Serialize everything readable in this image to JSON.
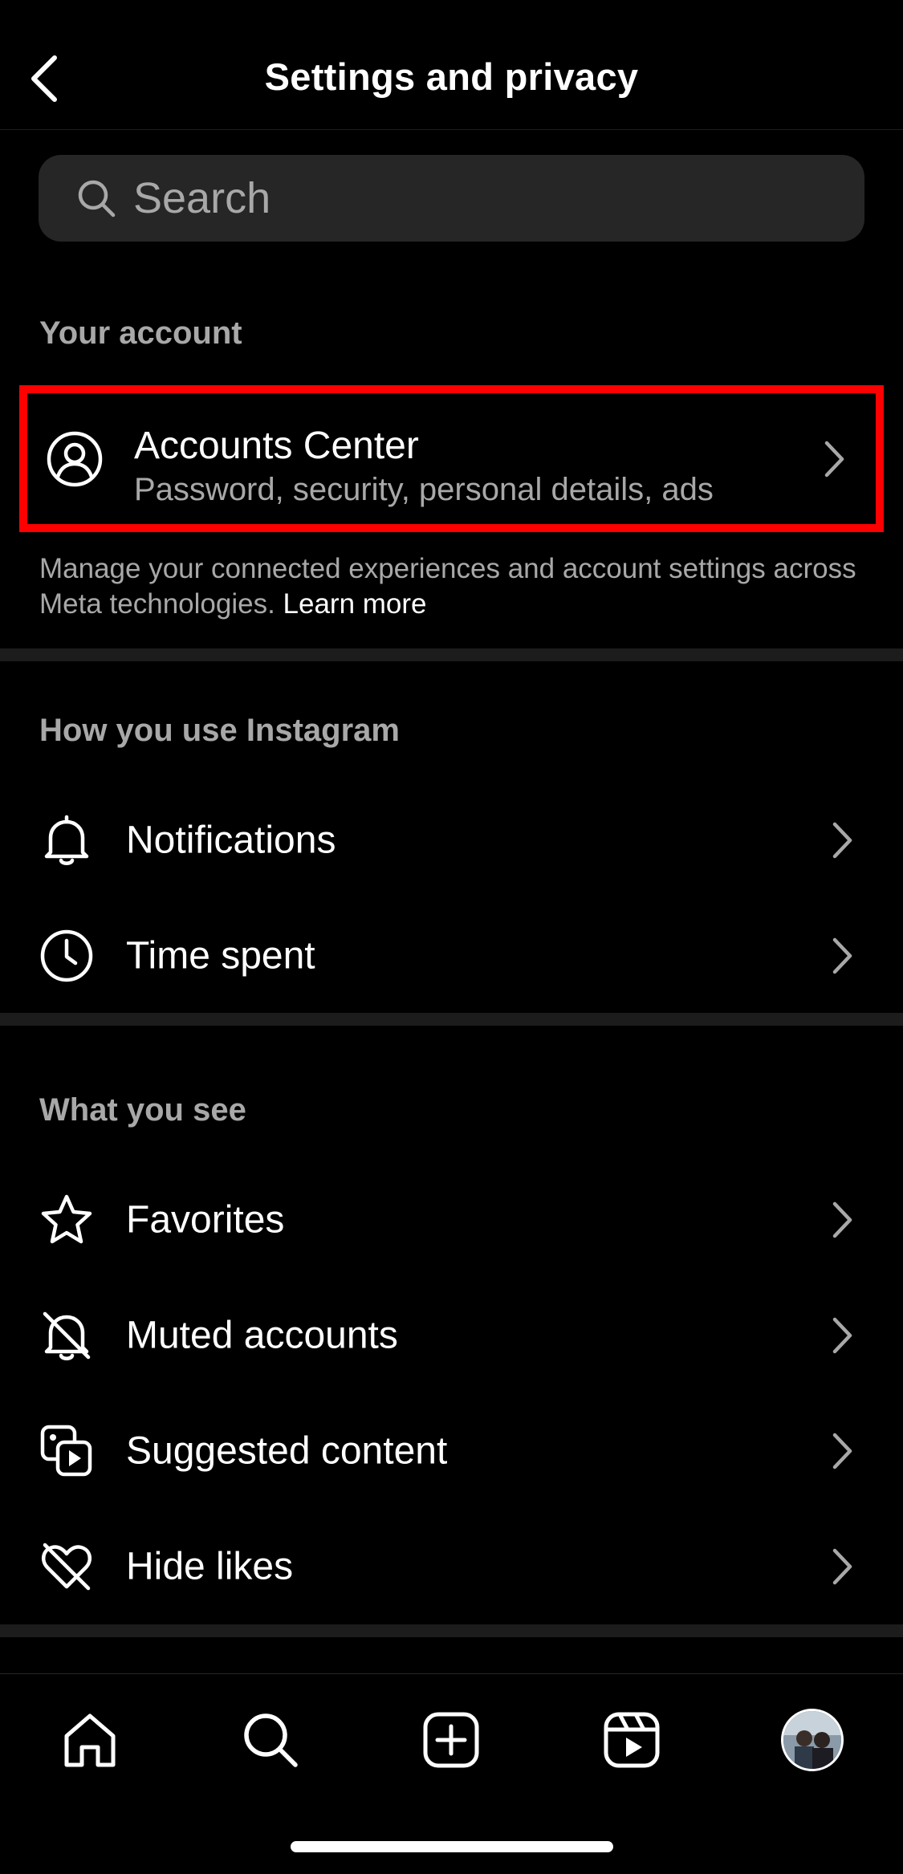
{
  "header": {
    "title": "Settings and privacy"
  },
  "search": {
    "placeholder": "Search"
  },
  "sections": {
    "your_account": {
      "label": "Your account",
      "accounts_center": {
        "title": "Accounts Center",
        "subtitle": "Password, security, personal details, ads"
      },
      "description": "Manage your connected experiences and account settings across Meta technologies.",
      "learn_more": "Learn more"
    },
    "how_you_use": {
      "label": "How you use Instagram",
      "items": [
        {
          "label": "Notifications",
          "icon": "bell-icon"
        },
        {
          "label": "Time spent",
          "icon": "clock-icon"
        }
      ]
    },
    "what_you_see": {
      "label": "What you see",
      "items": [
        {
          "label": "Favorites",
          "icon": "star-icon"
        },
        {
          "label": "Muted accounts",
          "icon": "muted-bell-icon"
        },
        {
          "label": "Suggested content",
          "icon": "suggested-content-icon"
        },
        {
          "label": "Hide likes",
          "icon": "heart-off-icon"
        }
      ]
    }
  },
  "bottom_nav": {
    "items": [
      "home-icon",
      "search-icon",
      "create-icon",
      "reels-icon",
      "profile-avatar"
    ]
  },
  "colors": {
    "background": "#000000",
    "highlight_box": "#ff0000",
    "secondary_text": "#a8a8a8",
    "search_bg": "#262626"
  }
}
